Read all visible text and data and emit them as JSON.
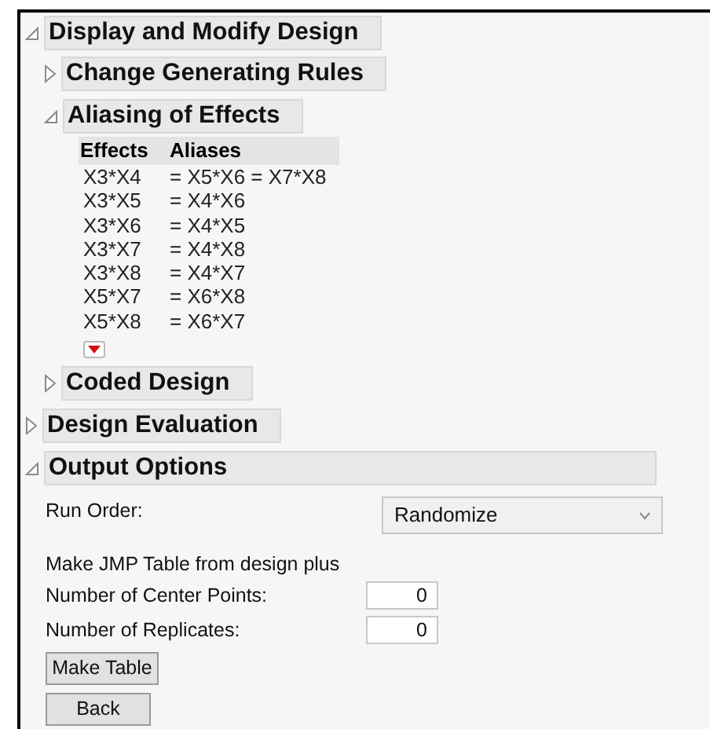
{
  "outline": [
    {
      "title": "Display and Modify Design",
      "expanded": true,
      "children": [
        {
          "title": "Change Generating Rules",
          "expanded": false
        },
        {
          "title": "Aliasing of Effects",
          "expanded": true,
          "kind": "alias_table",
          "columns": [
            "Effects",
            "Aliases"
          ],
          "rows": [
            {
              "effect": "X3*X4",
              "aliases": "= X5*X6 = X7*X8"
            },
            {
              "effect": "X3*X5",
              "aliases": "= X4*X6"
            },
            {
              "effect": "X3*X6",
              "aliases": "= X4*X5"
            },
            {
              "effect": "X3*X7",
              "aliases": "= X4*X8"
            },
            {
              "effect": "X3*X8",
              "aliases": "= X4*X7"
            },
            {
              "effect": "X5*X7",
              "aliases": "= X6*X8"
            },
            {
              "effect": "X5*X8",
              "aliases": "= X6*X7"
            }
          ]
        },
        {
          "title": "Coded Design",
          "expanded": false
        }
      ]
    },
    {
      "title": "Design Evaluation",
      "expanded": false
    },
    {
      "title": "Output Options",
      "expanded": true,
      "kind": "output_options",
      "run_order": {
        "label": "Run Order:",
        "value": "Randomize"
      },
      "note": "Make JMP Table from design plus",
      "fields": [
        {
          "label": "Number of Center Points:",
          "value": "0"
        },
        {
          "label": "Number of Replicates:",
          "value": "0"
        }
      ],
      "buttons": [
        "Make Table",
        "Back"
      ]
    }
  ]
}
